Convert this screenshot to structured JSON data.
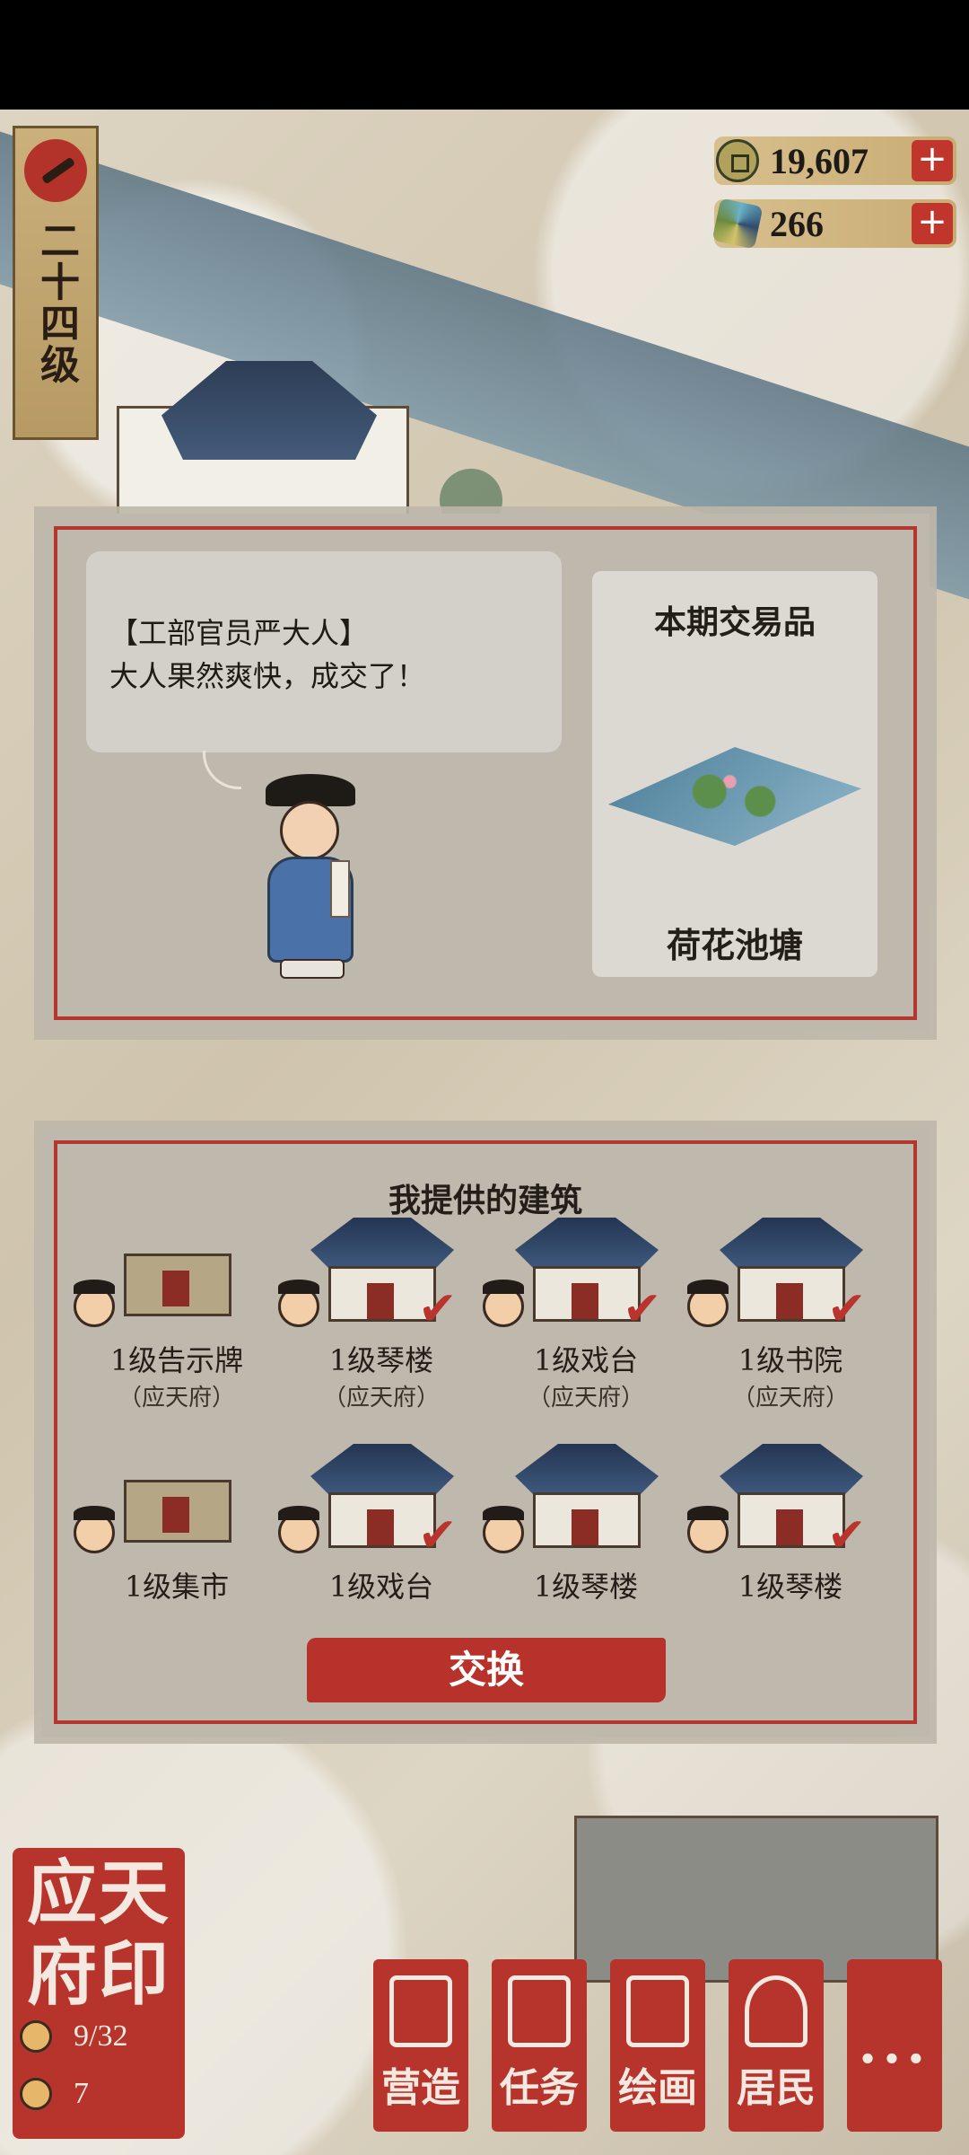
{
  "level": {
    "text": "二十四级"
  },
  "currency": [
    {
      "name": "coin",
      "value": "19,607",
      "plus": "+"
    },
    {
      "name": "jade",
      "value": "266",
      "plus": "+"
    }
  ],
  "dialog": {
    "speaker": "【工部官员严大人】",
    "speech": "大人果然爽快，成交了！"
  },
  "trade_item": {
    "title": "本期交易品",
    "name": "荷花池塘"
  },
  "offer": {
    "title": "我提供的建筑",
    "items": [
      {
        "label": "1级告示牌",
        "sub": "（应天府）",
        "checked": false
      },
      {
        "label": "1级琴楼",
        "sub": "（应天府）",
        "checked": true
      },
      {
        "label": "1级戏台",
        "sub": "（应天府）",
        "checked": true
      },
      {
        "label": "1级书院",
        "sub": "（应天府）",
        "checked": true
      },
      {
        "label": "1级集市",
        "sub": "",
        "checked": false
      },
      {
        "label": "1级戏台",
        "sub": "",
        "checked": true
      },
      {
        "label": "1级琴楼",
        "sub": "",
        "checked": false
      },
      {
        "label": "1级琴楼",
        "sub": "",
        "checked": true
      }
    ],
    "check_mark": "✔"
  },
  "swap_button": "交换",
  "seal": {
    "title": "应天府印",
    "residents": "9/32",
    "count": "7"
  },
  "menu": [
    {
      "label": "营造",
      "icon": "building-icon"
    },
    {
      "label": "任务",
      "icon": "book-icon"
    },
    {
      "label": "绘画",
      "icon": "scroll-icon"
    },
    {
      "label": "居民",
      "icon": "person-icon"
    },
    {
      "label": "...",
      "icon": "more-icon"
    }
  ]
}
